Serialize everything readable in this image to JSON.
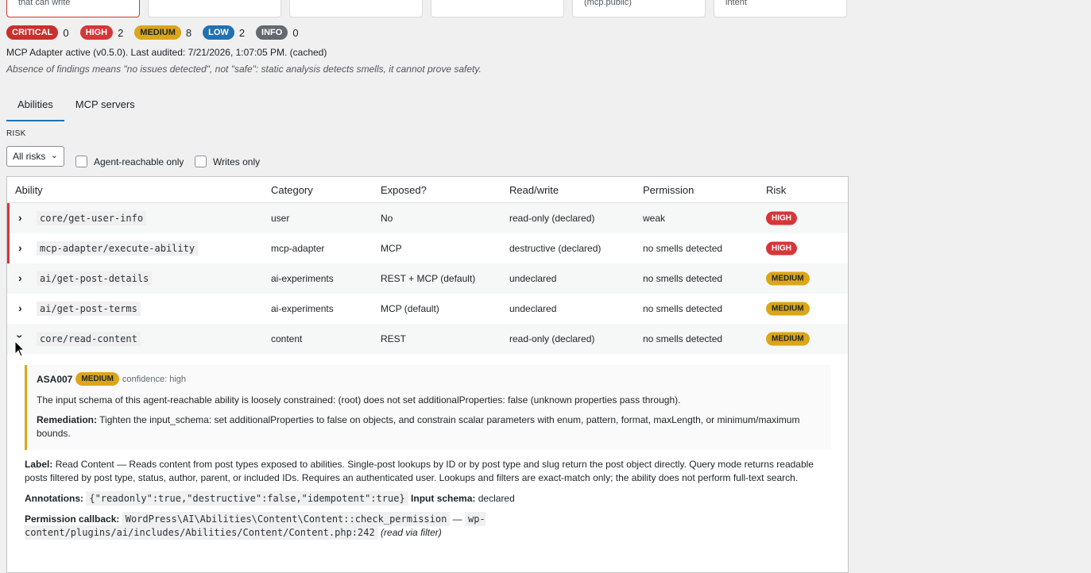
{
  "cards": [
    {
      "text": "that can write"
    },
    {
      "text": ""
    },
    {
      "text": ""
    },
    {
      "text": ""
    },
    {
      "text": "(mcp.public)"
    },
    {
      "text": "intent"
    }
  ],
  "severity": [
    {
      "label": "CRITICAL",
      "count": "0"
    },
    {
      "label": "HIGH",
      "count": "2"
    },
    {
      "label": "MEDIUM",
      "count": "8"
    },
    {
      "label": "LOW",
      "count": "2"
    },
    {
      "label": "INFO",
      "count": "0"
    }
  ],
  "status_text": "MCP Adapter active (v0.5.0). Last audited: 7/21/2026, 1:07:05 PM. (cached)",
  "disclaimer": "Absence of findings means \"no issues detected\", not \"safe\": static analysis detects smells, it cannot prove safety.",
  "tabs": [
    {
      "label": "Abilities"
    },
    {
      "label": "MCP servers"
    }
  ],
  "filters": {
    "risk_label": "RISK",
    "risk_value": "All risks",
    "agent_reachable_label": "Agent-reachable only",
    "writes_only_label": "Writes only"
  },
  "table": {
    "headers": {
      "ability": "Ability",
      "category": "Category",
      "exposed": "Exposed?",
      "readwrite": "Read/write",
      "permission": "Permission",
      "risk": "Risk"
    },
    "rows": [
      {
        "ability": "core/get-user-info",
        "category": "user",
        "exposed": "No",
        "readwrite": "read-only (declared)",
        "permission": "weak",
        "risk": "HIGH"
      },
      {
        "ability": "mcp-adapter/execute-ability",
        "category": "mcp-adapter",
        "exposed": "MCP",
        "readwrite": "destructive (declared)",
        "permission": "no smells detected",
        "risk": "HIGH"
      },
      {
        "ability": "ai/get-post-details",
        "category": "ai-experiments",
        "exposed": "REST + MCP (default)",
        "readwrite": "undeclared",
        "permission": "no smells detected",
        "risk": "MEDIUM"
      },
      {
        "ability": "ai/get-post-terms",
        "category": "ai-experiments",
        "exposed": "MCP (default)",
        "readwrite": "undeclared",
        "permission": "no smells detected",
        "risk": "MEDIUM"
      },
      {
        "ability": "core/read-content",
        "category": "content",
        "exposed": "REST",
        "readwrite": "read-only (declared)",
        "permission": "no smells detected",
        "risk": "MEDIUM"
      }
    ]
  },
  "finding": {
    "id": "ASA007",
    "severity": "MEDIUM",
    "confidence": "confidence: high",
    "description": "The input schema of this agent-reachable ability is loosely constrained: (root) does not set additionalProperties: false (unknown properties pass through).",
    "remediation_label": "Remediation:",
    "remediation": "Tighten the input_schema: set additionalProperties to false on objects, and constrain scalar parameters with enum, pattern, format, maxLength, or minimum/maximum bounds."
  },
  "details": {
    "label_label": "Label:",
    "label_text": "Read Content — Reads content from post types exposed to abilities. Single-post lookups by ID or by post type and slug return the post object directly. Query mode returns readable posts filtered by post type, status, author, parent, or included IDs. Requires an authenticated user. Lookups and filters are exact-match only; the ability does not perform full-text search.",
    "annotations_label": "Annotations:",
    "annotations_code": "{\"readonly\":true,\"destructive\":false,\"idempotent\":true}",
    "input_schema_label": "Input schema:",
    "input_schema_value": "declared",
    "permission_label": "Permission callback:",
    "permission_code": "WordPress\\AI\\Abilities\\Content\\Content::check_permission",
    "dash": "—",
    "permission_path": "wp-content/plugins/ai/includes/Abilities/Content/Content.php:242",
    "permission_note": "(read via filter)"
  }
}
